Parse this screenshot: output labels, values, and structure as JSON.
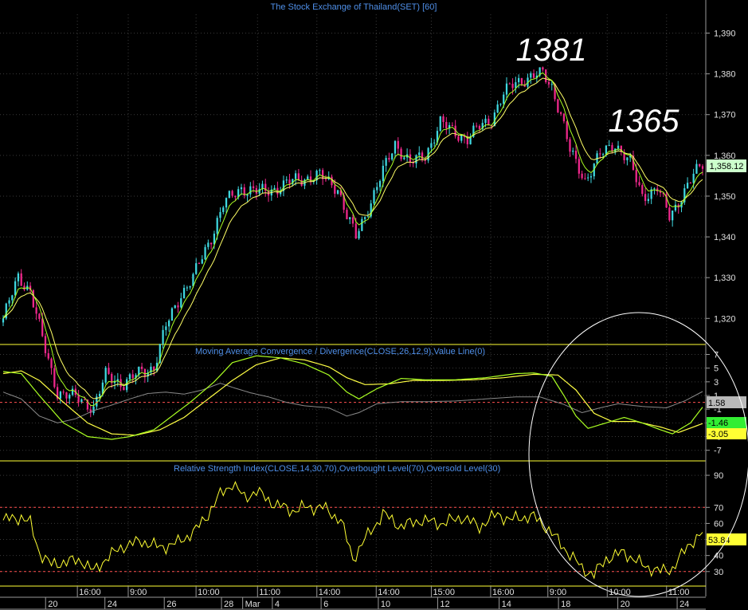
{
  "window": {
    "title": "The Stock Exchange of Thailand(SET) [60]"
  },
  "colors": {
    "background": "#000000",
    "grid": "#3a3a3a",
    "title_text": "#4f8fe8",
    "axis_text": "#e0e0e0",
    "bull_candle": "#3fd8e0",
    "bear_candle": "#f0288c",
    "ma_fast": "#aaff22",
    "ma_slow": "#ffff66",
    "panel_border": "#ffff33",
    "macd_line": "#aaff22",
    "signal_line": "#ffff44",
    "value_line": "#8a8a8a",
    "zero_line": "#ff5050",
    "rsi_line": "#ffff33",
    "rsi_levels": "#ff5050",
    "annotation": "#ffffff",
    "last_price_tag": "#ccffcc"
  },
  "annotations": [
    {
      "label": "1381"
    },
    {
      "label": "1365"
    }
  ],
  "last_price_tag": "1,358.12",
  "chart_data": [
    {
      "type": "candlestick",
      "title": "The Stock Exchange of Thailand(SET) [60]",
      "y_ticks": [
        "1,390",
        "1,380",
        "1,370",
        "1,360",
        "1,350",
        "1,340",
        "1,330",
        "1,320"
      ],
      "y_tick_values": [
        1390,
        1380,
        1370,
        1360,
        1350,
        1340,
        1330,
        1320
      ],
      "ylim": [
        1313.6,
        1394.6
      ],
      "grid": true,
      "anchor_closes": [
        [
          0,
          1320
        ],
        [
          5,
          1330
        ],
        [
          9,
          1327
        ],
        [
          14,
          1312
        ],
        [
          18,
          1302
        ],
        [
          26,
          1300
        ],
        [
          30,
          1298
        ],
        [
          34,
          1306
        ],
        [
          40,
          1304
        ],
        [
          46,
          1307
        ],
        [
          50,
          1308
        ],
        [
          54,
          1318
        ],
        [
          59,
          1326
        ],
        [
          63,
          1330
        ],
        [
          69,
          1340
        ],
        [
          73,
          1348
        ],
        [
          79,
          1352
        ],
        [
          85,
          1351
        ],
        [
          91,
          1352
        ],
        [
          97,
          1354
        ],
        [
          105,
          1355
        ],
        [
          111,
          1352
        ],
        [
          114,
          1345
        ],
        [
          117,
          1340
        ],
        [
          121,
          1347
        ],
        [
          126,
          1356
        ],
        [
          130,
          1363
        ],
        [
          135,
          1358
        ],
        [
          140,
          1360
        ],
        [
          145,
          1368
        ],
        [
          149,
          1366
        ],
        [
          154,
          1364
        ],
        [
          158,
          1367
        ],
        [
          162,
          1369
        ],
        [
          166,
          1375
        ],
        [
          170,
          1378
        ],
        [
          174,
          1379
        ],
        [
          179,
          1380
        ],
        [
          182,
          1377
        ],
        [
          185,
          1370
        ],
        [
          188,
          1361
        ],
        [
          193,
          1354
        ],
        [
          198,
          1360
        ],
        [
          203,
          1363
        ],
        [
          208,
          1358
        ],
        [
          212,
          1350
        ],
        [
          217,
          1352
        ],
        [
          221,
          1345
        ],
        [
          225,
          1350
        ],
        [
          229,
          1355
        ],
        [
          232,
          1358
        ]
      ],
      "bar_count": 233
    },
    {
      "type": "line",
      "title": "Moving Average Convergence / Divergence(CLOSE,26,12,9),Value Line(0)",
      "y_ticks": [
        "7",
        "5",
        "3",
        "1",
        "-1",
        "-3",
        "-5",
        "-7"
      ],
      "y_tick_values": [
        7,
        5,
        3,
        1,
        -1,
        -3,
        -5,
        -7
      ],
      "ylim": [
        -8.55,
        8.34
      ],
      "grid": true,
      "value_labels": {
        "signal": "1.58",
        "macd": "-1.46",
        "histogram": "-3.05"
      },
      "series": [
        {
          "key": "macd",
          "values_anchor": [
            [
              0,
              4.5
            ],
            [
              6,
              4.2
            ],
            [
              12,
              1
            ],
            [
              20,
              -3
            ],
            [
              28,
              -5
            ],
            [
              36,
              -5.4
            ],
            [
              42,
              -5
            ],
            [
              50,
              -4
            ],
            [
              56,
              -2
            ],
            [
              62,
              0
            ],
            [
              70,
              3
            ],
            [
              76,
              5.8
            ],
            [
              84,
              6.8
            ],
            [
              92,
              6.5
            ],
            [
              100,
              5.6
            ],
            [
              108,
              4
            ],
            [
              114,
              1.5
            ],
            [
              118,
              0.5
            ],
            [
              124,
              2
            ],
            [
              132,
              3.5
            ],
            [
              140,
              3.3
            ],
            [
              150,
              3.3
            ],
            [
              160,
              3.6
            ],
            [
              170,
              4.2
            ],
            [
              176,
              4.3
            ],
            [
              182,
              3.8
            ],
            [
              186,
              1
            ],
            [
              190,
              -2
            ],
            [
              194,
              -3.8
            ],
            [
              200,
              -3
            ],
            [
              206,
              -2.2
            ],
            [
              212,
              -3
            ],
            [
              218,
              -4
            ],
            [
              222,
              -4.6
            ],
            [
              228,
              -3
            ],
            [
              232,
              -0.7
            ]
          ]
        },
        {
          "key": "signal",
          "values_anchor": [
            [
              0,
              4.2
            ],
            [
              6,
              4.6
            ],
            [
              12,
              3.2
            ],
            [
              20,
              0
            ],
            [
              28,
              -3
            ],
            [
              36,
              -4.6
            ],
            [
              44,
              -4.8
            ],
            [
              52,
              -4
            ],
            [
              60,
              -2.2
            ],
            [
              68,
              0.5
            ],
            [
              76,
              3.2
            ],
            [
              84,
              5.5
            ],
            [
              92,
              6.5
            ],
            [
              100,
              6.2
            ],
            [
              108,
              5.2
            ],
            [
              114,
              3.6
            ],
            [
              120,
              2.6
            ],
            [
              128,
              2.7
            ],
            [
              136,
              3.2
            ],
            [
              146,
              3.2
            ],
            [
              156,
              3.3
            ],
            [
              166,
              3.6
            ],
            [
              176,
              4.1
            ],
            [
              184,
              4
            ],
            [
              190,
              1.8
            ],
            [
              196,
              -1.6
            ],
            [
              202,
              -2.8
            ],
            [
              210,
              -2.8
            ],
            [
              218,
              -3.6
            ],
            [
              224,
              -4.4
            ],
            [
              232,
              -3.1
            ]
          ]
        },
        {
          "key": "value_line",
          "values_anchor": [
            [
              0,
              1.5
            ],
            [
              6,
              0.5
            ],
            [
              12,
              -2
            ],
            [
              18,
              -3
            ],
            [
              24,
              -2.4
            ],
            [
              30,
              -1.2
            ],
            [
              36,
              -0.4
            ],
            [
              42,
              0.5
            ],
            [
              48,
              1.3
            ],
            [
              54,
              1.5
            ],
            [
              60,
              1.2
            ],
            [
              66,
              1.8
            ],
            [
              72,
              2.8
            ],
            [
              76,
              2.2
            ],
            [
              82,
              1.4
            ],
            [
              88,
              0.8
            ],
            [
              94,
              0
            ],
            [
              100,
              -0.5
            ],
            [
              108,
              -0.8
            ],
            [
              114,
              -2
            ],
            [
              118,
              -1.5
            ],
            [
              124,
              -0.2
            ],
            [
              132,
              0.1
            ],
            [
              140,
              0.1
            ],
            [
              150,
              0.2
            ],
            [
              160,
              0.5
            ],
            [
              170,
              0.8
            ],
            [
              178,
              0.8
            ],
            [
              186,
              -0.3
            ],
            [
              192,
              -1.5
            ],
            [
              198,
              -0.8
            ],
            [
              204,
              -0.2
            ],
            [
              212,
              -0.6
            ],
            [
              220,
              -0.8
            ],
            [
              226,
              0.2
            ],
            [
              232,
              1.58
            ]
          ]
        }
      ],
      "zero_level": 0
    },
    {
      "type": "line",
      "title": "Relative Strength Index(CLOSE,14,30,70),Overbought Level(70),Oversold Level(30)",
      "y_ticks": [
        "90",
        "70",
        "60",
        "50",
        "40",
        "30"
      ],
      "y_tick_values": [
        90,
        70,
        60,
        50,
        40,
        30
      ],
      "ylim": [
        20.95,
        98.48
      ],
      "grid": true,
      "value_label": "53.84",
      "levels": [
        70,
        30
      ],
      "values_anchor": [
        [
          0,
          62
        ],
        [
          6,
          64
        ],
        [
          9,
          60
        ],
        [
          12,
          42
        ],
        [
          16,
          34
        ],
        [
          20,
          36
        ],
        [
          26,
          37
        ],
        [
          30,
          30
        ],
        [
          34,
          38
        ],
        [
          40,
          46
        ],
        [
          46,
          49
        ],
        [
          52,
          45
        ],
        [
          58,
          48
        ],
        [
          64,
          56
        ],
        [
          68,
          66
        ],
        [
          72,
          78
        ],
        [
          76,
          85
        ],
        [
          80,
          76
        ],
        [
          84,
          80
        ],
        [
          90,
          72
        ],
        [
          96,
          68
        ],
        [
          100,
          70
        ],
        [
          106,
          70
        ],
        [
          112,
          62
        ],
        [
          116,
          38
        ],
        [
          120,
          50
        ],
        [
          126,
          66
        ],
        [
          132,
          58
        ],
        [
          138,
          62
        ],
        [
          146,
          60
        ],
        [
          152,
          64
        ],
        [
          158,
          58
        ],
        [
          164,
          66
        ],
        [
          168,
          62
        ],
        [
          172,
          64
        ],
        [
          176,
          64
        ],
        [
          180,
          58
        ],
        [
          186,
          45
        ],
        [
          192,
          32
        ],
        [
          196,
          28
        ],
        [
          200,
          38
        ],
        [
          206,
          42
        ],
        [
          212,
          34
        ],
        [
          218,
          30
        ],
        [
          222,
          32
        ],
        [
          228,
          48
        ],
        [
          232,
          53.84
        ]
      ]
    }
  ],
  "x_axis": {
    "top_row": [
      {
        "label": "16:00",
        "bar": 35
      },
      {
        "label": "9:00",
        "bar": 59
      },
      {
        "label": "10:00",
        "bar": 91
      },
      {
        "label": "11:00",
        "bar": 120
      },
      {
        "label": "14:00",
        "bar": 148
      },
      {
        "label": "14:00",
        "bar": 176
      },
      {
        "label": "15:00",
        "bar": 202
      },
      {
        "label": "16:00",
        "bar": 230
      },
      {
        "label": "9:00",
        "bar": 257
      },
      {
        "label": "10:00",
        "bar": 285
      },
      {
        "label": "11:00",
        "bar": 313
      }
    ],
    "bottom_row": [
      {
        "label": "20",
        "bar": 20
      },
      {
        "label": "24",
        "bar": 48
      },
      {
        "label": "26",
        "bar": 76
      },
      {
        "label": "28",
        "bar": 103
      },
      {
        "label": "Mar",
        "bar": 113
      },
      {
        "label": "4",
        "bar": 127
      },
      {
        "label": "6",
        "bar": 150
      },
      {
        "label": "10",
        "bar": 177
      },
      {
        "label": "12",
        "bar": 205
      },
      {
        "label": "14",
        "bar": 234
      },
      {
        "label": "18",
        "bar": 262
      },
      {
        "label": "20",
        "bar": 290
      },
      {
        "label": "24",
        "bar": 318
      }
    ]
  }
}
